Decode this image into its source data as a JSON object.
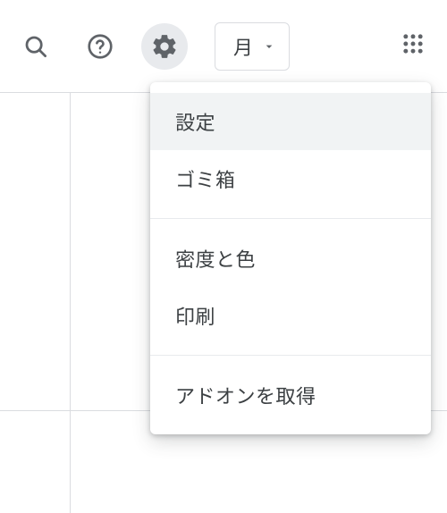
{
  "toolbar": {
    "search_icon": "search-icon",
    "help_icon": "help-icon",
    "settings_icon": "gear-icon",
    "apps_icon": "apps-grid-icon"
  },
  "view_selector": {
    "label": "月"
  },
  "settings_menu": {
    "items": {
      "settings": "設定",
      "trash": "ゴミ箱",
      "density": "密度と色",
      "print": "印刷",
      "addons": "アドオンを取得"
    }
  }
}
